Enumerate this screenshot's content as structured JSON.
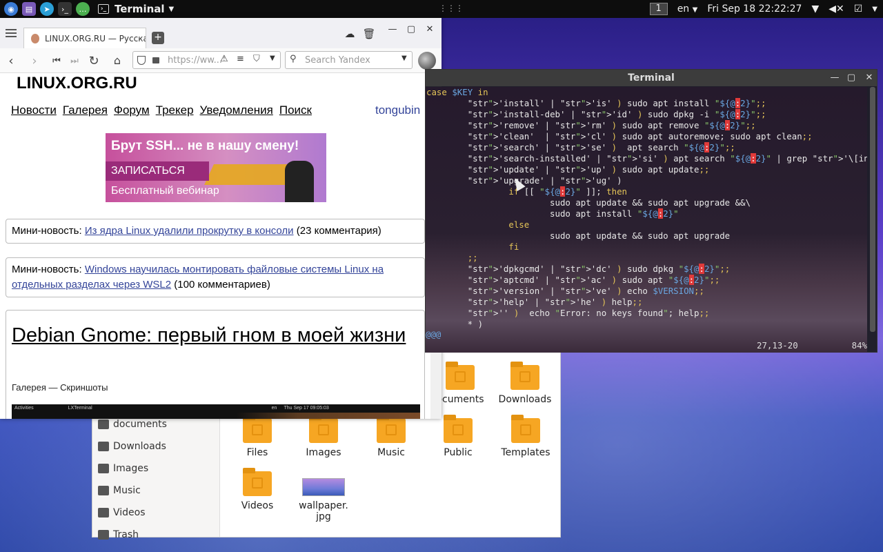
{
  "top_panel": {
    "app_name": "Terminal",
    "workspace": "1",
    "keyboard_layout": "en",
    "clock": "Fri Sep 18  22:22:27"
  },
  "browser": {
    "tab_title": "LINUX.ORG.RU — Русская",
    "url_placeholder": "https://ww...",
    "search_placeholder": "Search Yandex",
    "site_title": "LINUX.ORG.RU",
    "nav_items": [
      "Новости",
      "Галерея",
      "Форум",
      "Трекер",
      "Уведомления",
      "Поиск"
    ],
    "user_name": "tongubin",
    "banner": {
      "headline": "Брут SSH... не в нашу смену!",
      "cta": "ЗАПИСАТЬСЯ",
      "sub": "Бесплатный вебинар"
    },
    "news": [
      {
        "prefix": "Мини-новость:",
        "link": "Из ядра Linux удалили прокрутку в консоли",
        "suffix": "(23 комментария)"
      },
      {
        "prefix": "Мини-новость:",
        "link": "Windows научилась монтировать файловые системы Linux на отдельных разделах через WSL2",
        "suffix": "(100 комментариев)"
      }
    ],
    "article": {
      "title": "Debian Gnome: первый гном в моей жизни",
      "category": "Галерея — Скриншоты",
      "screenshot_bar": [
        "Activities",
        "LXTerminal",
        "en",
        "Thu Sep 17  09:05:03"
      ]
    }
  },
  "terminal": {
    "title": "Terminal",
    "lines": [
      "case $KEY in",
      "        'install' | 'is' ) sudo apt install \"${@:2}\";;",
      "        'install-deb' | 'id' ) sudo dpkg -i \"${@:2}\";;",
      "        'remove' | 'rm' ) sudo apt remove \"${@:2}\";;",
      "        'clean'  | 'cl' ) sudo apt autoremove; sudo apt clean;;",
      "        'search' | 'se' )  apt search \"${@:2}\";;",
      "        'search-installed' | 'si' ) apt search \"${@:2}\" | grep '\\[installed\\]';;",
      "        'update' | 'up' ) sudo apt update;;",
      "        'upgrade' | 'ug' )",
      "                if [[ \"${@:2}\" ]]; then",
      "                        sudo apt update && sudo apt upgrade &&\\",
      "                        sudo apt install \"${@:2}\"",
      "                else",
      "                        sudo apt update && sudo apt upgrade",
      "                fi",
      "        ;;",
      "        'dpkgcmd' | 'dc' ) sudo dpkg \"${@:2}\";;",
      "        'aptcmd' | 'ac' ) sudo apt \"${@:2}\";;",
      "        'version' | 've' ) echo $VERSION;;",
      "        'help' | 'he' ) help;;",
      "        '' )  echo \"Error: no keys found\"; help;;",
      "        * )"
    ],
    "prompt": "@@@",
    "cursor_pos": "27,13-20",
    "scroll_pct": "84%"
  },
  "files": {
    "sidebar": [
      "documents",
      "Downloads",
      "Images",
      "Music",
      "Videos",
      "Trash"
    ],
    "items_row1": [
      "ocuments",
      "Downloads"
    ],
    "items_row2": [
      "Files",
      "Images",
      "Music",
      "Public",
      "Templates"
    ],
    "items_row3": [
      "Videos",
      "wallpaper.\njpg"
    ]
  }
}
